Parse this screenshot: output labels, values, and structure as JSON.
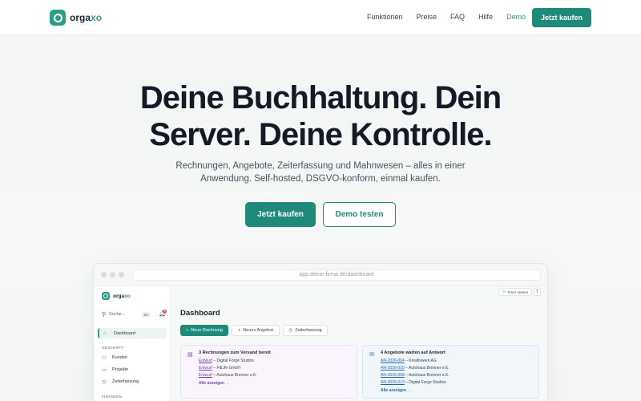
{
  "brand": {
    "name_main": "orga",
    "name_accent": "xo"
  },
  "colors": {
    "accent": "#1f8a7a",
    "brand": "#2a9d8b"
  },
  "nav": {
    "links": [
      "Funktionen",
      "Preise",
      "FAQ",
      "Hilfe",
      "Demo"
    ],
    "active_link": "Demo",
    "cta": "Jetzt kaufen"
  },
  "hero": {
    "title_line1": "Deine Buchhaltung. Dein",
    "title_line2": "Server. Deine Kontrolle.",
    "subtitle_line1": "Rechnungen, Angebote, Zeiterfassung und Mahnwesen – alles in einer",
    "subtitle_line2": "Anwendung. Self-hosted, DSGVO-konform, einmal kaufen.",
    "primary_button": "Jetzt kaufen",
    "secondary_button": "Demo testen"
  },
  "app": {
    "url": "app.deine-firma.de/dashboard",
    "sidebar": {
      "search_label": "Suche...",
      "search_kbd": "⌘K",
      "notification_count": "3",
      "items": [
        {
          "label": "Dashboard",
          "icon": "home-icon",
          "active": true
        }
      ],
      "section_geschaeft": "GESCHÄFT",
      "geschaeft_items": [
        {
          "label": "Kunden",
          "icon": "users-icon"
        },
        {
          "label": "Projekte",
          "icon": "folder-icon"
        },
        {
          "label": "Zeiterfassung",
          "icon": "clock-icon"
        }
      ],
      "section_finanzen": "FINANZEN"
    },
    "timer_label": "Timer starten",
    "timer_key": "T",
    "title": "Dashboard",
    "actions": {
      "new_invoice": "Neue Rechnung",
      "new_quote": "Neues Angebot",
      "time_tracking": "Zeiterfassung"
    },
    "cards": {
      "invoices": {
        "title": "3 Rechnungen zum Versand bereit",
        "rows": [
          {
            "tag": "Entwurf",
            "text": " – Digital Forge Studios"
          },
          {
            "tag": "Entwurf",
            "text": " – FitLife GmbH"
          },
          {
            "tag": "Entwurf",
            "text": " – Autohaus Brenner e.K."
          }
        ],
        "link": "Alle anzeigen →"
      },
      "quotes": {
        "title": "4 Angebote warten auf Antwort",
        "rows": [
          {
            "tag": "AN-2026-004",
            "text": " – Kreativwerk AG"
          },
          {
            "tag": "AN-2026-010",
            "text": " – Autohaus Brenner e.K."
          },
          {
            "tag": "AN-2026-008",
            "text": " – Autohaus Brenner e.K."
          },
          {
            "tag": "AN-2026-013",
            "text": " – Digital Forge Studios"
          }
        ],
        "link": "Alle anzeigen →"
      }
    }
  }
}
